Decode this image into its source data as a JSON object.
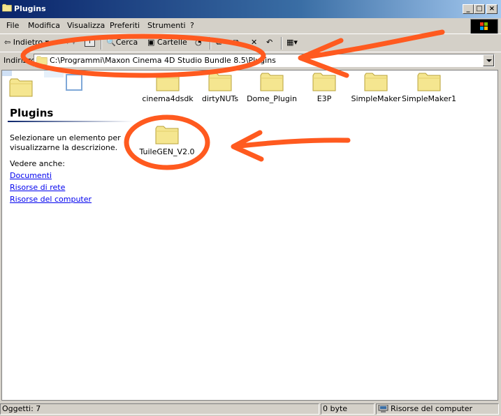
{
  "window": {
    "title": "Plugins"
  },
  "menu": [
    "File",
    "Modifica",
    "Visualizza",
    "Preferiti",
    "Strumenti",
    "?"
  ],
  "toolbar": {
    "back_label": "Indietro",
    "search_label": "Cerca",
    "folders_label": "Cartelle"
  },
  "address": {
    "label": "Indirizzo",
    "path": "C:\\Programmi\\Maxon Cinema 4D Studio Bundle 8.5\\Plugins"
  },
  "sidebar": {
    "title": "Plugins",
    "description": "Selezionare un elemento per visualizzarne la descrizione.",
    "see_also": "Vedere anche:",
    "links": [
      "Documenti",
      "Risorse di rete",
      "Risorse del computer"
    ]
  },
  "folders": [
    "cinema4dsdk",
    "dirtyNUTs",
    "Dome_Plugin",
    "E3P",
    "SimpleMaker",
    "SimpleMaker1",
    "TuileGEN_V2.0"
  ],
  "status": {
    "objects": "Oggetti: 7",
    "size": "0 byte",
    "location": "Risorse del computer"
  },
  "colors": {
    "title_bar": "#0a246a",
    "folder": "#f5e690",
    "annotation": "#ff5a1f",
    "link": "#0000ee"
  }
}
